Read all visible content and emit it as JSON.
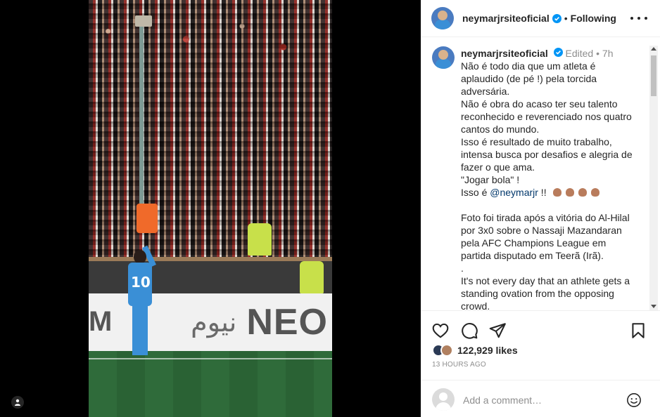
{
  "post": {
    "username": "neymarjrsiteoficial",
    "follow_status": "Following",
    "media": {
      "banner_arabic": "نيوم",
      "banner_brand": "NEO",
      "banner_left": "M",
      "player_number": "10"
    }
  },
  "caption": {
    "username": "neymarjrsiteoficial",
    "edited": "Edited",
    "separator": "•",
    "time": "7h",
    "lines": [
      "Não é todo dia que um atleta é",
      "aplaudido (de pé !) pela torcida",
      "adversária.",
      "Não é obra do acaso ter seu talento",
      "reconhecido e reverenciado nos quatro",
      "cantos do mundo.",
      "Isso é resultado de muito trabalho,",
      "intensa busca por desafios e alegria de",
      "fazer o que ama.",
      "\"Jogar bola\" !"
    ],
    "mention_prefix": "Isso é ",
    "mention": "@neymarjr",
    "mention_suffix": " !!",
    "lines2": [
      "Foto foi tirada após a vitória do Al-Hilal",
      "por 3x0 sobre o Nassaji Mazandaran",
      "pela AFC Champions League em",
      "partida disputado em Teerã (Irã).",
      ".",
      "It's not every day that an athlete gets a",
      "standing ovation from the opposing",
      "crowd."
    ]
  },
  "engagement": {
    "likes": "122,929 likes",
    "time_ago": "13 HOURS AGO"
  },
  "comment": {
    "placeholder": "Add a comment…"
  },
  "icons": {
    "heart": "heart-icon",
    "comment": "comment-icon",
    "share": "share-icon",
    "save": "bookmark-icon",
    "emoji": "emoji-icon",
    "more": "more-icon",
    "verified": "verified-icon",
    "tag": "user-tag-icon"
  },
  "colors": {
    "verified": "#0095f6",
    "link": "#00376b",
    "muted": "#8e8e8e",
    "text": "#262626"
  }
}
